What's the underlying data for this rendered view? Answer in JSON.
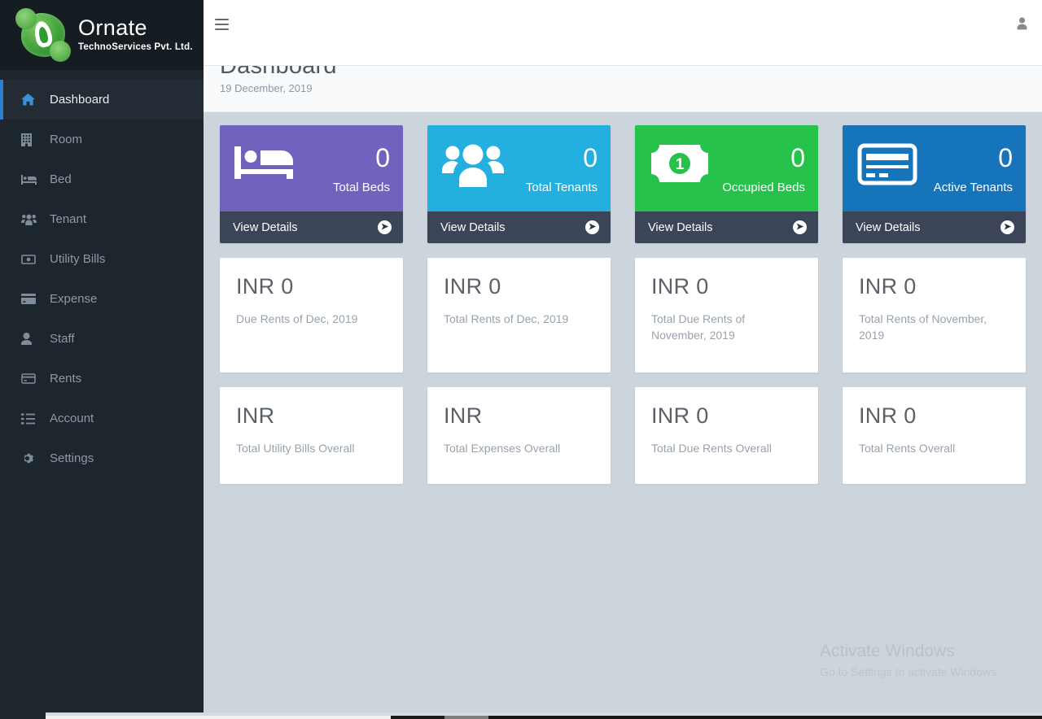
{
  "brand": {
    "name": "Ornate",
    "subtitle": "TechnoServices Pvt. Ltd.",
    "logo_icon": "ornate-leaf-logo"
  },
  "sidebar": {
    "items": [
      {
        "label": "",
        "icon": "partial-item",
        "active": false,
        "partial": true
      },
      {
        "label": "Dashboard",
        "icon": "home-icon",
        "active": true
      },
      {
        "label": "Room",
        "icon": "building-icon",
        "active": false
      },
      {
        "label": "Bed",
        "icon": "bed-icon",
        "active": false
      },
      {
        "label": "Tenant",
        "icon": "users-icon",
        "active": false
      },
      {
        "label": "Utility Bills",
        "icon": "money-bill-icon",
        "active": false
      },
      {
        "label": "Expense",
        "icon": "credit-card-icon",
        "active": false
      },
      {
        "label": "Staff",
        "icon": "user-icon",
        "active": false
      },
      {
        "label": "Rents",
        "icon": "card-icon",
        "active": false
      },
      {
        "label": "Account",
        "icon": "list-ol-icon",
        "active": false
      },
      {
        "label": "Settings",
        "icon": "gear-icon",
        "active": false
      }
    ]
  },
  "topbar": {
    "menu_icon": "hamburger-icon",
    "user_icon": "user-avatar-icon"
  },
  "page": {
    "title": "Dashboard",
    "date": "19 December, 2019"
  },
  "stat_cards": [
    {
      "value": "0",
      "label": "Total Beds",
      "footer_label": "View Details",
      "icon": "bed-icon",
      "color": "#6f63bd",
      "footer_color": "#3c4458"
    },
    {
      "value": "0",
      "label": "Total Tenants",
      "footer_label": "View Details",
      "icon": "users-icon",
      "color": "#23b0e0",
      "footer_color": "#3c4458"
    },
    {
      "value": "0",
      "label": "Occupied Beds",
      "footer_label": "View Details",
      "icon": "money-bill-icon",
      "color": "#27c24c",
      "footer_color": "#3c4458"
    },
    {
      "value": "0",
      "label": "Active Tenants",
      "footer_label": "View Details",
      "icon": "credit-card-icon",
      "color": "#1674bb",
      "footer_color": "#3c4458"
    }
  ],
  "info_cards_row1": [
    {
      "value": "INR 0",
      "label": "Due Rents of Dec, 2019"
    },
    {
      "value": "INR 0",
      "label": "Total Rents of Dec, 2019"
    },
    {
      "value": "INR 0",
      "label": "Total Due Rents of November, 2019"
    },
    {
      "value": "INR 0",
      "label": "Total Rents of November, 2019"
    }
  ],
  "info_cards_row2": [
    {
      "value": "INR",
      "label": "Total Utility Bills Overall"
    },
    {
      "value": "INR",
      "label": "Total Expenses Overall"
    },
    {
      "value": "INR 0",
      "label": "Total Due Rents Overall"
    },
    {
      "value": "INR 0",
      "label": "Total Rents Overall"
    }
  ],
  "watermark": {
    "title": "Activate Windows",
    "subtitle": "Go to Settings to activate Windows."
  }
}
